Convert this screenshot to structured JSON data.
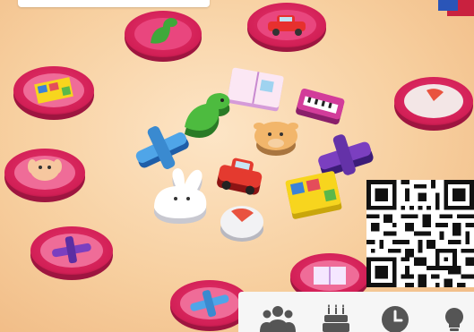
{
  "game": {
    "disc_color": "#d8235a",
    "disc_rim_color": "#ef7aa2",
    "disc_items": [
      "dinosaur",
      "car",
      "shape-blocks",
      "dial",
      "dog",
      "airplane",
      "airplane",
      "book"
    ],
    "pieces": [
      "book",
      "piano",
      "dinosaur",
      "giraffe",
      "airplane",
      "airplane",
      "car",
      "shape-blocks",
      "rabbit",
      "dial"
    ]
  },
  "info_bar": {
    "icons": [
      "players-icon",
      "age-cake-icon",
      "clock-icon",
      "lightbulb-icon"
    ],
    "icon_color": "#555555"
  },
  "colors": {
    "background": "#f7cf9f",
    "panel": "#f6f6f6",
    "box_red": "#c9213f",
    "box_blue": "#2a55b8"
  }
}
